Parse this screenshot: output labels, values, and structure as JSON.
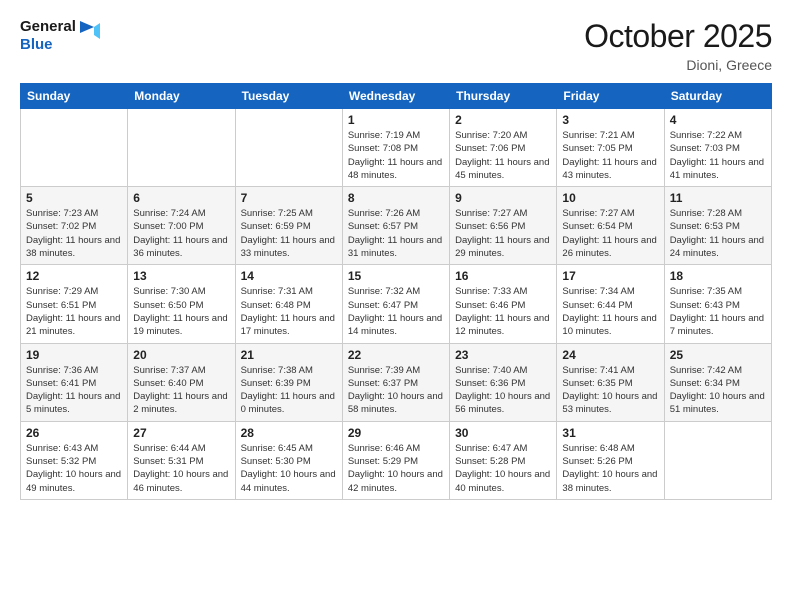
{
  "logo": {
    "line1": "General",
    "line2": "Blue"
  },
  "title": "October 2025",
  "location": "Dioni, Greece",
  "days_header": [
    "Sunday",
    "Monday",
    "Tuesday",
    "Wednesday",
    "Thursday",
    "Friday",
    "Saturday"
  ],
  "weeks": [
    [
      {
        "day": "",
        "text": ""
      },
      {
        "day": "",
        "text": ""
      },
      {
        "day": "",
        "text": ""
      },
      {
        "day": "1",
        "text": "Sunrise: 7:19 AM\nSunset: 7:08 PM\nDaylight: 11 hours and 48 minutes."
      },
      {
        "day": "2",
        "text": "Sunrise: 7:20 AM\nSunset: 7:06 PM\nDaylight: 11 hours and 45 minutes."
      },
      {
        "day": "3",
        "text": "Sunrise: 7:21 AM\nSunset: 7:05 PM\nDaylight: 11 hours and 43 minutes."
      },
      {
        "day": "4",
        "text": "Sunrise: 7:22 AM\nSunset: 7:03 PM\nDaylight: 11 hours and 41 minutes."
      }
    ],
    [
      {
        "day": "5",
        "text": "Sunrise: 7:23 AM\nSunset: 7:02 PM\nDaylight: 11 hours and 38 minutes."
      },
      {
        "day": "6",
        "text": "Sunrise: 7:24 AM\nSunset: 7:00 PM\nDaylight: 11 hours and 36 minutes."
      },
      {
        "day": "7",
        "text": "Sunrise: 7:25 AM\nSunset: 6:59 PM\nDaylight: 11 hours and 33 minutes."
      },
      {
        "day": "8",
        "text": "Sunrise: 7:26 AM\nSunset: 6:57 PM\nDaylight: 11 hours and 31 minutes."
      },
      {
        "day": "9",
        "text": "Sunrise: 7:27 AM\nSunset: 6:56 PM\nDaylight: 11 hours and 29 minutes."
      },
      {
        "day": "10",
        "text": "Sunrise: 7:27 AM\nSunset: 6:54 PM\nDaylight: 11 hours and 26 minutes."
      },
      {
        "day": "11",
        "text": "Sunrise: 7:28 AM\nSunset: 6:53 PM\nDaylight: 11 hours and 24 minutes."
      }
    ],
    [
      {
        "day": "12",
        "text": "Sunrise: 7:29 AM\nSunset: 6:51 PM\nDaylight: 11 hours and 21 minutes."
      },
      {
        "day": "13",
        "text": "Sunrise: 7:30 AM\nSunset: 6:50 PM\nDaylight: 11 hours and 19 minutes."
      },
      {
        "day": "14",
        "text": "Sunrise: 7:31 AM\nSunset: 6:48 PM\nDaylight: 11 hours and 17 minutes."
      },
      {
        "day": "15",
        "text": "Sunrise: 7:32 AM\nSunset: 6:47 PM\nDaylight: 11 hours and 14 minutes."
      },
      {
        "day": "16",
        "text": "Sunrise: 7:33 AM\nSunset: 6:46 PM\nDaylight: 11 hours and 12 minutes."
      },
      {
        "day": "17",
        "text": "Sunrise: 7:34 AM\nSunset: 6:44 PM\nDaylight: 11 hours and 10 minutes."
      },
      {
        "day": "18",
        "text": "Sunrise: 7:35 AM\nSunset: 6:43 PM\nDaylight: 11 hours and 7 minutes."
      }
    ],
    [
      {
        "day": "19",
        "text": "Sunrise: 7:36 AM\nSunset: 6:41 PM\nDaylight: 11 hours and 5 minutes."
      },
      {
        "day": "20",
        "text": "Sunrise: 7:37 AM\nSunset: 6:40 PM\nDaylight: 11 hours and 2 minutes."
      },
      {
        "day": "21",
        "text": "Sunrise: 7:38 AM\nSunset: 6:39 PM\nDaylight: 11 hours and 0 minutes."
      },
      {
        "day": "22",
        "text": "Sunrise: 7:39 AM\nSunset: 6:37 PM\nDaylight: 10 hours and 58 minutes."
      },
      {
        "day": "23",
        "text": "Sunrise: 7:40 AM\nSunset: 6:36 PM\nDaylight: 10 hours and 56 minutes."
      },
      {
        "day": "24",
        "text": "Sunrise: 7:41 AM\nSunset: 6:35 PM\nDaylight: 10 hours and 53 minutes."
      },
      {
        "day": "25",
        "text": "Sunrise: 7:42 AM\nSunset: 6:34 PM\nDaylight: 10 hours and 51 minutes."
      }
    ],
    [
      {
        "day": "26",
        "text": "Sunrise: 6:43 AM\nSunset: 5:32 PM\nDaylight: 10 hours and 49 minutes."
      },
      {
        "day": "27",
        "text": "Sunrise: 6:44 AM\nSunset: 5:31 PM\nDaylight: 10 hours and 46 minutes."
      },
      {
        "day": "28",
        "text": "Sunrise: 6:45 AM\nSunset: 5:30 PM\nDaylight: 10 hours and 44 minutes."
      },
      {
        "day": "29",
        "text": "Sunrise: 6:46 AM\nSunset: 5:29 PM\nDaylight: 10 hours and 42 minutes."
      },
      {
        "day": "30",
        "text": "Sunrise: 6:47 AM\nSunset: 5:28 PM\nDaylight: 10 hours and 40 minutes."
      },
      {
        "day": "31",
        "text": "Sunrise: 6:48 AM\nSunset: 5:26 PM\nDaylight: 10 hours and 38 minutes."
      },
      {
        "day": "",
        "text": ""
      }
    ]
  ]
}
